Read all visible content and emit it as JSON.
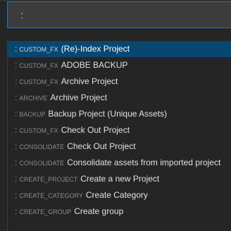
{
  "palette": {
    "input": {
      "value": ":",
      "placeholder": ""
    },
    "items": [
      {
        "category": "CUSTOM_FX",
        "label": "(Re)-Index Project",
        "selected": true
      },
      {
        "category": "CUSTOM_FX",
        "label": "ADOBE BACKUP",
        "selected": false
      },
      {
        "category": "CUSTOM_FX",
        "label": "Archive Project",
        "selected": false
      },
      {
        "category": "ARCHIVE",
        "label": "Archive Project",
        "selected": false
      },
      {
        "category": "BACKUP",
        "label": "Backup Project (Unique Assets)",
        "selected": false
      },
      {
        "category": "CUSTOM_FX",
        "label": "Check Out Project",
        "selected": false
      },
      {
        "category": "CONSOLIDATE",
        "label": "Check Out Project",
        "selected": false
      },
      {
        "category": "CONSOLIDATE",
        "label": "Consolidate assets from imported project",
        "selected": false
      },
      {
        "category": "CREATE_PROJECT",
        "label": "Create a new Project",
        "selected": false
      },
      {
        "category": "CREATE_CATEGORY",
        "label": "Create Category",
        "selected": false
      },
      {
        "category": "CREATE_GROUP",
        "label": "Create group",
        "selected": false
      }
    ]
  },
  "colors": {
    "selection": "#094771",
    "input_border": "#007fd4",
    "input_background": "#3c3c3c",
    "panel_background": "#252526"
  }
}
